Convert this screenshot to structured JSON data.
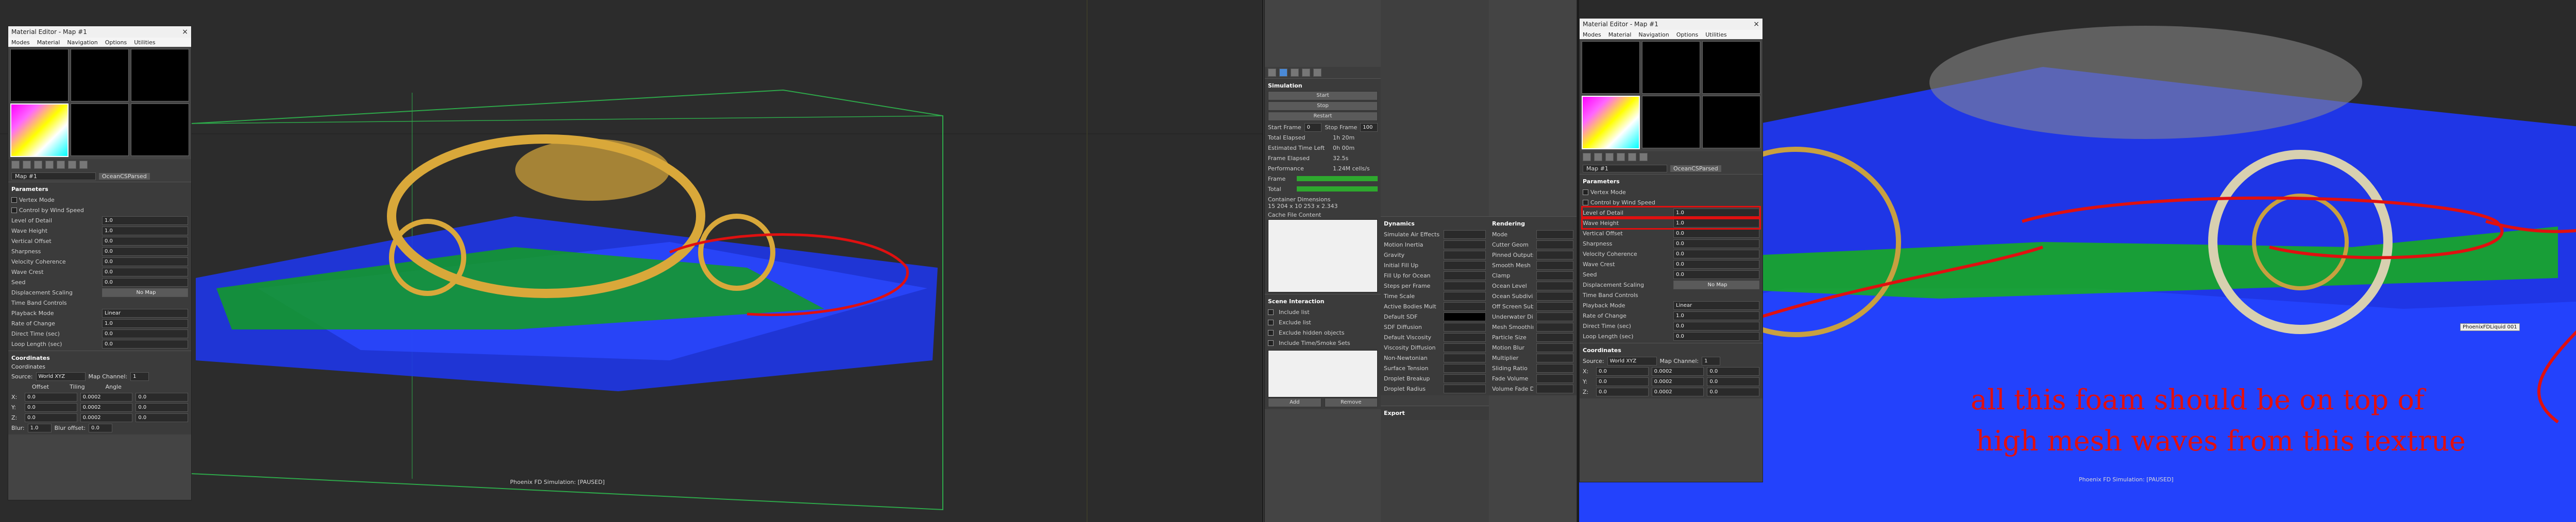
{
  "left_window": {
    "title": "Material Editor - Map #1",
    "close": "×",
    "menu": [
      "Modes",
      "Material",
      "Navigation",
      "Options",
      "Utilities"
    ],
    "map_name": "Map #1",
    "map_type": "OceanCSParsed"
  },
  "params": {
    "header": "Parameters",
    "rows": [
      {
        "label": "Vertex Mode",
        "value": "",
        "check": true
      },
      {
        "label": "Control by Wind Speed",
        "value": "",
        "check": true
      },
      {
        "label": "Level of Detail",
        "value": "1.0"
      },
      {
        "label": "Wave Height",
        "value": "1.0"
      },
      {
        "label": "Vertical Offset",
        "value": "0.0"
      },
      {
        "label": "Sharpness",
        "value": "0.0"
      },
      {
        "label": "Velocity Coherence",
        "value": "0.0"
      },
      {
        "label": "Wave Crest",
        "value": "0.0"
      },
      {
        "label": "Seed",
        "value": "0.0"
      },
      {
        "label": "Displacement Scaling",
        "value": "No Map"
      },
      {
        "label": "Time Band Controls",
        "value": ""
      },
      {
        "label": "Playback Mode",
        "value": "Linear"
      },
      {
        "label": "Rate of Change",
        "value": "1.0"
      },
      {
        "label": "Direct Time (sec)",
        "value": "0.0"
      },
      {
        "label": "Loop Length (sec)",
        "value": "0.0"
      }
    ]
  },
  "coords": {
    "header": "Coordinates",
    "sub": "Coordinates",
    "source_label": "Source:",
    "source": "World XYZ",
    "map_channel_label": "Map Channel:",
    "map_channel": "1",
    "offset_label": "Offset",
    "tiling_label": "Tiling",
    "angle_label": "Angle",
    "rows": [
      {
        "axis": "X:",
        "offset": "0.0",
        "tiling": "0.0002",
        "angle": "0.0"
      },
      {
        "axis": "Y:",
        "offset": "0.0",
        "tiling": "0.0002",
        "angle": "0.0"
      },
      {
        "axis": "Z:",
        "offset": "0.0",
        "tiling": "0.0002",
        "angle": "0.0"
      }
    ],
    "blur_label": "Blur:",
    "blur": "1.0",
    "blur_offset_label": "Blur offset:",
    "blur_offset": "0.0"
  },
  "viewport_labels": {
    "left": "Phoenix FD Simulation: [PAUSED]",
    "right": "Phoenix FD Simulation: [PAUSED]",
    "tag": "PhoenixFDLiquid 001"
  },
  "sim_panel": {
    "simulation_header": "Simulation",
    "buttons": [
      "Start",
      "Stop",
      "Restart"
    ],
    "start_frame_label": "Start Frame",
    "stop_frame_label": "Stop Frame",
    "start_frame": "0",
    "stop_frame": "100",
    "stats": [
      {
        "label": "Total Elapsed",
        "value": "1h 20m"
      },
      {
        "label": "Estimated Time Left",
        "value": "0h 00m"
      },
      {
        "label": "Frame Elapsed",
        "value": "32.5s"
      },
      {
        "label": "Performance",
        "value": "1.24M cells/s"
      }
    ],
    "frame_label": "Frame",
    "total_label": "Total",
    "container_label": "Container Dimensions",
    "container_value": "15 204 x 10 253 x 2.343",
    "cache_label": "Cache File Content",
    "dynamics_header": "Dynamics",
    "dynamics": [
      "Simulate Air Effects",
      "Motion Inertia",
      "Gravity",
      "Initial Fill Up",
      "Fill Up for Ocean",
      "Steps per Frame",
      "Time Scale",
      "Active Bodies Mult",
      "Default SDF",
      "SDF Diffusion",
      "Default Viscosity",
      "Viscosity Diffusion",
      "Non-Newtonian",
      "Surface Tension",
      "Droplet Breakup",
      "Droplet Radius"
    ],
    "scene_header": "Scene Interaction",
    "scene_items": [
      "Include list",
      "Exclude list",
      "Exclude hidden objects",
      "Include Time/Smoke Sets"
    ],
    "add_label": "Add",
    "remove_label": "Remove",
    "export_label": "Export"
  },
  "rendering_panel": {
    "header": "Rendering",
    "items": [
      "Mode",
      "Cutter Geom",
      "Pinned Outputs",
      "Smooth Mesh",
      "Clamp",
      "Ocean Level",
      "Ocean Subdivision",
      "Off Screen Subd",
      "Underwater Display",
      "Mesh Smoothing",
      "Particle Size",
      "Motion Blur",
      "Multiplier",
      "Sliding Ratio",
      "Fade Volume",
      "Volume Fade Dist"
    ]
  },
  "annotation": {
    "line1": "all this foam should be on top of",
    "line2": "high mesh waves from this textrue",
    "color": "#e01010"
  },
  "colors": {
    "wire_blue": "#1f3cff",
    "wire_yellow": "#e0b23a",
    "foam_green": "#18b418",
    "container_green": "#2ea84a"
  }
}
